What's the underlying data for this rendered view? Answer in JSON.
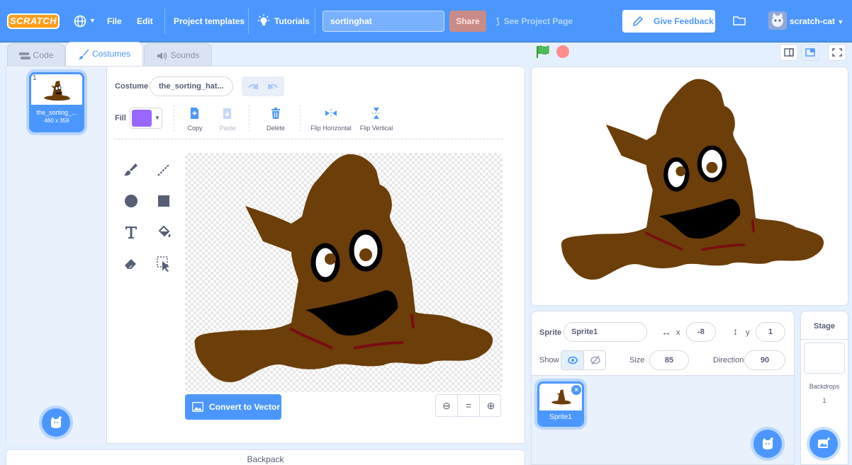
{
  "menubar": {
    "logo": "SCRATCH",
    "file": "File",
    "edit": "Edit",
    "project_templates": "Project templates",
    "tutorials": "Tutorials",
    "project_title": "sortinghat",
    "share": "Share",
    "see_project_page": "See Project Page",
    "give_feedback": "Give Feedback",
    "username": "scratch-cat"
  },
  "tabs": {
    "code": "Code",
    "costumes": "Costumes",
    "sounds": "Sounds"
  },
  "costume_list": {
    "items": [
      {
        "number": "1",
        "name": "the_sorting_...",
        "size": "460 x 359"
      }
    ]
  },
  "paint_editor": {
    "costume_label": "Costume",
    "costume_name": "the_sorting_hat...",
    "fill_label": "Fill",
    "fill_color": "#9966ff",
    "actions": {
      "copy": "Copy",
      "paste": "Paste",
      "delete": "Delete",
      "flip_horizontal": "Flip Horizontal",
      "flip_vertical": "Flip Vertical"
    },
    "convert_button": "Convert to Vector",
    "zoom": {
      "out": "⊖",
      "reset": "=",
      "in": "⊕"
    }
  },
  "backpack": {
    "label": "Backpack"
  },
  "sprite_info": {
    "sprite_label": "Sprite",
    "sprite_name": "Sprite1",
    "x_label": "x",
    "x_value": "-8",
    "y_label": "y",
    "y_value": "1",
    "show_label": "Show",
    "size_label": "Size",
    "size_value": "85",
    "direction_label": "Direction",
    "direction_value": "90"
  },
  "sprite_list": {
    "items": [
      {
        "name": "Sprite1"
      }
    ]
  },
  "stage_panel": {
    "title": "Stage",
    "backdrops_label": "Backdrops",
    "backdrops_count": "1"
  },
  "colors": {
    "accent": "#4c97ff",
    "menubar": "#4c97ff",
    "hat_brown": "#6b3e0a",
    "fill": "#9966ff"
  }
}
